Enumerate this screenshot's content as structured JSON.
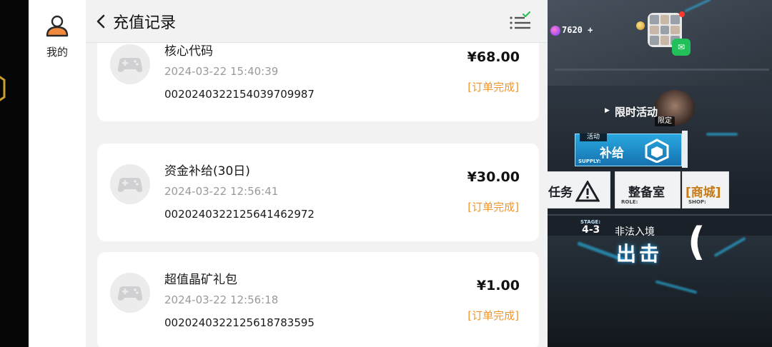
{
  "nav": {
    "mine_label": "我的"
  },
  "header": {
    "title": "充值记录"
  },
  "records": [
    {
      "name": "核心代码",
      "time": "2024-03-22 15:40:39",
      "order_no": "0020240322154039709987",
      "amount": "¥68.00",
      "status": "[订单完成]"
    },
    {
      "name": "资金补给(30日)",
      "time": "2024-03-22 12:56:41",
      "order_no": "0020240322125641462972",
      "amount": "¥30.00",
      "status": "[订单完成]"
    },
    {
      "name": "超值晶矿礼包",
      "time": "2024-03-22 12:56:18",
      "order_no": "0020240322125618783595",
      "amount": "¥1.00",
      "status": "[订单完成]"
    }
  ],
  "game": {
    "gem_count": "7620 +",
    "event_label": "限时活动",
    "event_tag": "限定",
    "supply_tag": "活动",
    "supply_label": "补给",
    "supply_sub": "SUPPLY:",
    "task_label": "任务",
    "prep_label": "整备室",
    "prep_sub": "ROLE:",
    "shop_label": "[商城]",
    "shop_sub": "SHOP:",
    "stage_tag": "STAGE:",
    "stage_no": "4-3",
    "stage_name": "非法入境",
    "sortie_label": "出击"
  },
  "colors": {
    "accent_orange": "#f0962a",
    "user_icon_orange": "#f08a3c",
    "filter_check_green": "#2dbe5a",
    "supply_blue": "#1f8fd0"
  }
}
